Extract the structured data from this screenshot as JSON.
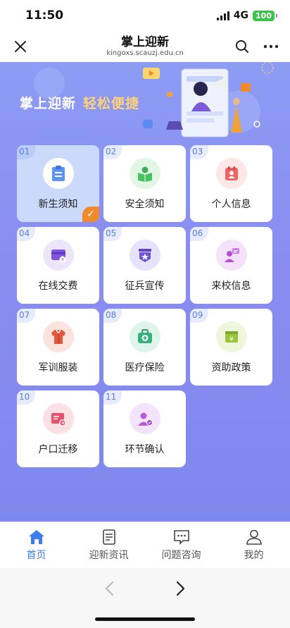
{
  "status": {
    "time": "11:50",
    "network": "4G",
    "battery": "100"
  },
  "header": {
    "title": "掌上迎新",
    "url": "kingoxs.scauzj.edu.cn"
  },
  "banner": {
    "slogan_main": "掌上迎新",
    "slogan_highlight": "轻松便捷"
  },
  "tiles": [
    {
      "num": "01",
      "label": "新生须知",
      "icon": "notice-icon",
      "checked": true
    },
    {
      "num": "02",
      "label": "安全须知",
      "icon": "safety-book-icon"
    },
    {
      "num": "03",
      "label": "个人信息",
      "icon": "id-card-icon"
    },
    {
      "num": "04",
      "label": "在线交费",
      "icon": "payment-icon"
    },
    {
      "num": "05",
      "label": "征兵宣传",
      "icon": "military-star-icon"
    },
    {
      "num": "06",
      "label": "来校信息",
      "icon": "person-message-icon"
    },
    {
      "num": "07",
      "label": "军训服装",
      "icon": "uniform-icon"
    },
    {
      "num": "08",
      "label": "医疗保险",
      "icon": "medical-kit-icon"
    },
    {
      "num": "09",
      "label": "资助政策",
      "icon": "financial-aid-icon"
    },
    {
      "num": "10",
      "label": "户口迁移",
      "icon": "household-transfer-icon"
    },
    {
      "num": "11",
      "label": "环节确认",
      "icon": "confirm-user-icon"
    }
  ],
  "tabbar": [
    {
      "label": "首页",
      "icon": "home-icon",
      "active": true
    },
    {
      "label": "迎新资讯",
      "icon": "news-icon"
    },
    {
      "label": "问题咨询",
      "icon": "chat-icon"
    },
    {
      "label": "我的",
      "icon": "user-icon"
    }
  ],
  "colors": {
    "accent": "#3e7df0",
    "background": "#8a8cf0",
    "highlight": "#ffd27a",
    "check": "#f08a2c"
  }
}
